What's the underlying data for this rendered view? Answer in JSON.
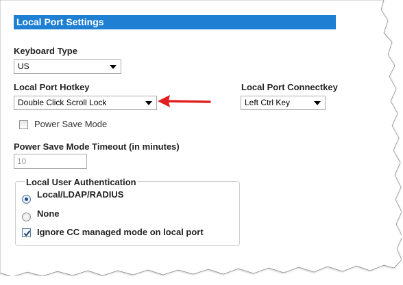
{
  "section": {
    "title": "Local Port Settings"
  },
  "keyboard_type": {
    "label": "Keyboard Type",
    "value": "US"
  },
  "local_port_hotkey": {
    "label": "Local Port Hotkey",
    "value": "Double Click Scroll Lock"
  },
  "local_port_connectkey": {
    "label": "Local Port Connectkey",
    "value": "Left Ctrl Key"
  },
  "power_save_mode": {
    "label": "Power Save Mode",
    "checked": false
  },
  "power_save_timeout": {
    "label": "Power Save Mode Timeout (in minutes)",
    "value": "10"
  },
  "local_user_auth": {
    "legend": "Local User Authentication",
    "options": [
      {
        "label": "Local/LDAP/RADIUS",
        "selected": true
      },
      {
        "label": "None",
        "selected": false
      }
    ],
    "ignore_cc": {
      "label": "Ignore CC managed mode on local port",
      "checked": true
    }
  },
  "colors": {
    "header_bg": "#1e7fd3",
    "header_text": "#ffffff",
    "annotation_arrow": "#e02020"
  }
}
